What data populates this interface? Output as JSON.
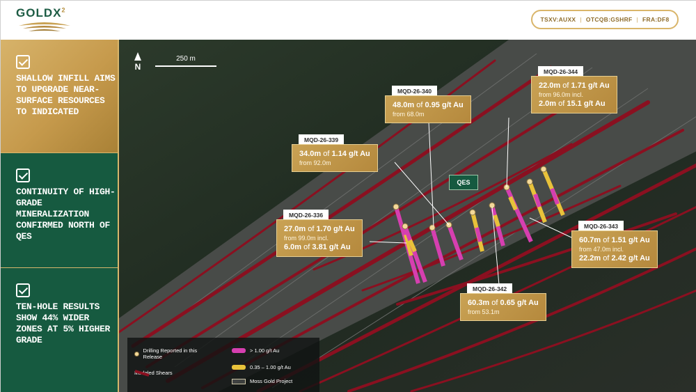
{
  "header": {
    "logo_text": "GOLDX",
    "logo_superscript": "2",
    "tickers": [
      "TSXV:AUXX",
      "OTCQB:GSHRF",
      "FRA:DF8"
    ]
  },
  "panels": [
    {
      "text": "Shallow infill aims to upgrade near-surface resources to indicated"
    },
    {
      "text": "Continuity of high-grade mineralization confirmed north of QES"
    },
    {
      "text": "Ten-hole results show 44% wider zones at 5% higher grade"
    }
  ],
  "map": {
    "north_label": "N",
    "scale_label": "250 m",
    "qes_label": "QES"
  },
  "callouts": [
    {
      "id": "MQD-26-340",
      "main": {
        "len": "48.0m",
        "grade": "0.95 g/t Au"
      },
      "from": "from 68.0m"
    },
    {
      "id": "MQD-26-344",
      "main": {
        "len": "22.0m",
        "grade": "1.71 g/t Au"
      },
      "from": "from 96.0m incl.",
      "incl": {
        "len": "2.0m",
        "grade": "15.1 g/t Au"
      }
    },
    {
      "id": "MQD-26-339",
      "main": {
        "len": "34.0m",
        "grade": "1.14 g/t Au"
      },
      "from": "from 92.0m"
    },
    {
      "id": "MQD-26-336",
      "main": {
        "len": "27.0m",
        "grade": "1.70 g/t Au"
      },
      "from": "from 99.0m incl.",
      "incl": {
        "len": "6.0m",
        "grade": "3.81 g/t Au"
      }
    },
    {
      "id": "MQD-26-343",
      "main": {
        "len": "60.7m",
        "grade": "1.51 g/t Au"
      },
      "from": "from 47.0m incl.",
      "incl": {
        "len": "22.2m",
        "grade": "2.42 g/t Au"
      }
    },
    {
      "id": "MQD-26-342",
      "main": {
        "len": "60.3m",
        "grade": "0.65 g/t Au"
      },
      "from": "from 53.1m"
    }
  ],
  "of_word": "of",
  "legend": {
    "drilling": "Drilling Reported in this Release",
    "shears": "Modeled Shears",
    "high": "> 1.00 g/t Au",
    "mid": "0.35 – 1.00 g/t Au",
    "project": "Moss Gold Project"
  },
  "colors": {
    "brand_green": "#165a40",
    "brand_gold": "#c69a4c",
    "shear_red": "#8a1020",
    "high_grade": "#d63fb0",
    "mid_grade": "#e8c23a"
  }
}
